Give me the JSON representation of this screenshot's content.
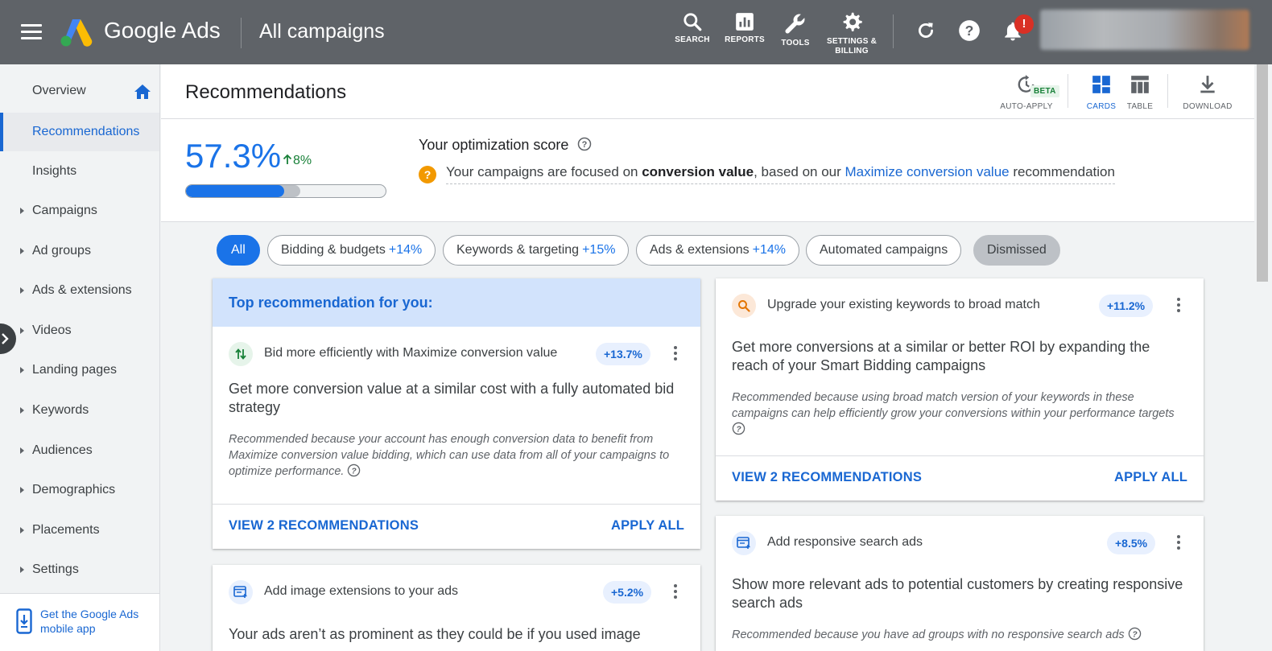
{
  "header": {
    "product_name": "Google Ads",
    "scope": "All campaigns",
    "tools": [
      {
        "label": "SEARCH",
        "icon": "search-icon"
      },
      {
        "label": "REPORTS",
        "icon": "reports-icon"
      },
      {
        "label": "TOOLS",
        "icon": "wrench-icon"
      },
      {
        "label": "SETTINGS &",
        "label2": "BILLING",
        "icon": "gear-icon"
      }
    ],
    "notification_badge": "!"
  },
  "sidebar": {
    "items": [
      {
        "label": "Overview"
      },
      {
        "label": "Recommendations"
      },
      {
        "label": "Insights"
      },
      {
        "label": "Campaigns"
      },
      {
        "label": "Ad groups"
      },
      {
        "label": "Ads & extensions"
      },
      {
        "label": "Videos"
      },
      {
        "label": "Landing pages"
      },
      {
        "label": "Keywords"
      },
      {
        "label": "Audiences"
      },
      {
        "label": "Demographics"
      },
      {
        "label": "Placements"
      },
      {
        "label": "Settings"
      }
    ],
    "mobile_app": "Get the Google Ads mobile app"
  },
  "main": {
    "title": "Recommendations",
    "views": {
      "auto_apply": "AUTO-APPLY",
      "beta": "BETA",
      "cards": "CARDS",
      "table": "TABLE",
      "download": "DOWNLOAD"
    },
    "score": {
      "value": "57.3%",
      "delta": "8%",
      "fill_fraction": 0.492,
      "potential_fraction": 0.573,
      "heading": "Your optimization score",
      "focus_prefix": "Your campaigns are focused on ",
      "focus_bold": "conversion value",
      "focus_mid": ", based on our ",
      "focus_link": "Maximize conversion value",
      "focus_suffix": " recommendation"
    },
    "chips": [
      {
        "label": "All",
        "pct": ""
      },
      {
        "label": "Bidding & budgets",
        "pct": "+14%"
      },
      {
        "label": "Keywords & targeting",
        "pct": "+15%"
      },
      {
        "label": "Ads & extensions",
        "pct": "+14%"
      },
      {
        "label": "Automated campaigns",
        "pct": ""
      },
      {
        "label": "Dismissed",
        "pct": ""
      }
    ],
    "cards": {
      "top_banner": "Top recommendation for you:",
      "c1": {
        "title": "Bid more efficiently with Maximize conversion value",
        "badge": "+13.7%",
        "main": "Get more conversion value at a similar cost with a fully automated bid strategy",
        "why": "Recommended because your account has enough conversion data to benefit from Maximize conversion value bidding, which can use data from all of your campaigns to optimize performance.",
        "view": "VIEW 2 RECOMMENDATIONS",
        "apply": "APPLY ALL"
      },
      "c2": {
        "title": "Add image extensions to your ads",
        "badge": "+5.2%",
        "main": "Your ads aren’t as prominent as they could be if you used image"
      },
      "c3": {
        "title": "Upgrade your existing keywords to broad match",
        "badge": "+11.2%",
        "main": "Get more conversions at a similar or better ROI by expanding the reach of your Smart Bidding campaigns",
        "why": "Recommended because using broad match version of your keywords in these campaigns can help efficiently grow your conversions within your performance targets",
        "view": "VIEW 2 RECOMMENDATIONS",
        "apply": "APPLY ALL"
      },
      "c4": {
        "title": "Add responsive search ads",
        "badge": "+8.5%",
        "main": "Show more relevant ads to potential customers by creating responsive search ads",
        "why": "Recommended because you have ad groups with no responsive search ads"
      }
    }
  },
  "colors": {
    "header_bg": "#5f6368",
    "accent": "#1a73e8",
    "link": "#1967d2",
    "positive": "#188038",
    "alert": "#d93025"
  }
}
